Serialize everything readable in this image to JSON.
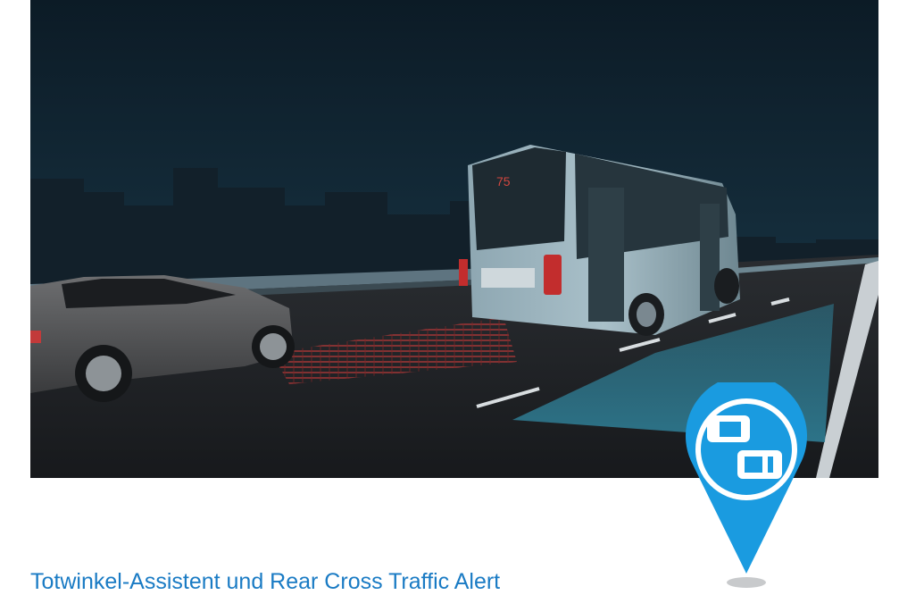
{
  "caption": {
    "text": "Totwinkel-Assistent und Rear Cross Traffic Alert"
  },
  "hero": {
    "bus_display": "75"
  },
  "pin_icon": {
    "name": "blind-spot-cars-icon",
    "color": "#1a9be0"
  },
  "colors": {
    "caption": "#1a7bc4",
    "blind_spot_zone": "#2f7d94",
    "warning_zone": "#b23333"
  }
}
